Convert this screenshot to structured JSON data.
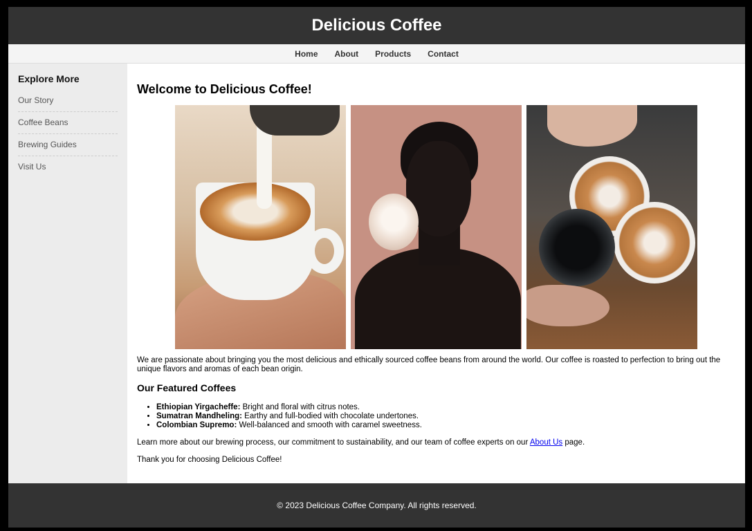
{
  "header": {
    "title": "Delicious Coffee"
  },
  "nav": {
    "items": [
      "Home",
      "About",
      "Products",
      "Contact"
    ]
  },
  "sidebar": {
    "heading": "Explore More",
    "items": [
      "Our Story",
      "Coffee Beans",
      "Brewing Guides",
      "Visit Us"
    ]
  },
  "main": {
    "title": "Welcome to Delicious Coffee!",
    "intro": "We are passionate about bringing you the most delicious and ethically sourced coffee beans from around the world. Our coffee is roasted to perfection to bring out the unique flavors and aromas of each bean origin.",
    "featured_heading": "Our Featured Coffees",
    "featured": [
      {
        "name": "Ethiopian Yirgacheffe:",
        "desc": " Bright and floral with citrus notes."
      },
      {
        "name": "Sumatran Mandheling:",
        "desc": " Earthy and full-bodied with chocolate undertones."
      },
      {
        "name": "Colombian Supremo:",
        "desc": " Well-balanced and smooth with caramel sweetness."
      }
    ],
    "learn_before": "Learn more about our brewing process, our commitment to sustainability, and our team of coffee experts on our ",
    "learn_link": "About Us",
    "learn_after": " page.",
    "thanks": "Thank you for choosing Delicious Coffee!"
  },
  "footer": {
    "text": "© 2023 Delicious Coffee Company. All rights reserved."
  }
}
